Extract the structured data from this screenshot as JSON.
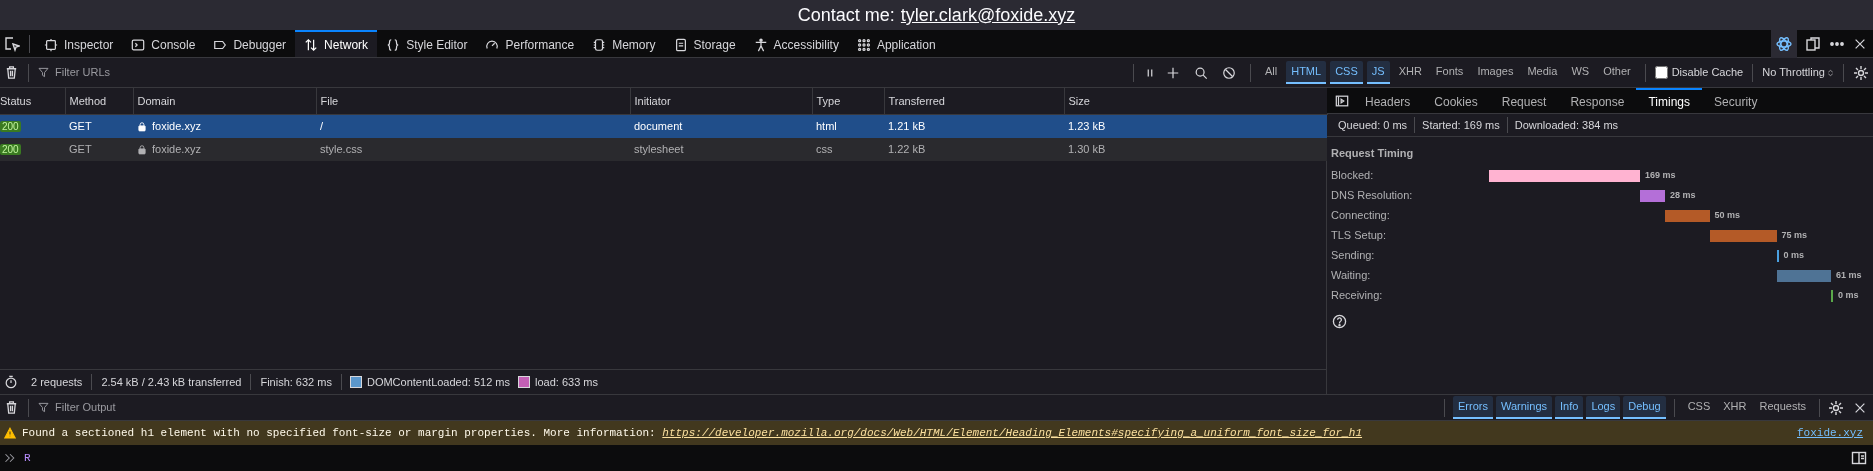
{
  "page": {
    "contact_label": "Contact me:",
    "contact_link": "tyler.clark@foxide.xyz"
  },
  "toolbox_tabs": [
    {
      "kind": "inspector",
      "label": "Inspector",
      "selected": false
    },
    {
      "kind": "console",
      "label": "Console",
      "selected": false
    },
    {
      "kind": "debugger",
      "label": "Debugger",
      "selected": false
    },
    {
      "kind": "network",
      "label": "Network",
      "selected": true
    },
    {
      "kind": "style",
      "label": "Style Editor",
      "selected": false
    },
    {
      "kind": "performance",
      "label": "Performance",
      "selected": false
    },
    {
      "kind": "memory",
      "label": "Memory",
      "selected": false
    },
    {
      "kind": "storage",
      "label": "Storage",
      "selected": false
    },
    {
      "kind": "accessibility",
      "label": "Accessibility",
      "selected": false
    },
    {
      "kind": "application",
      "label": "Application",
      "selected": false
    }
  ],
  "filter_bar": {
    "placeholder": "Filter URLs",
    "type_filters": [
      {
        "label": "All",
        "selected": false
      },
      {
        "label": "HTML",
        "selected": true
      },
      {
        "label": "CSS",
        "selected": true
      },
      {
        "label": "JS",
        "selected": true
      },
      {
        "label": "XHR",
        "selected": false
      },
      {
        "label": "Fonts",
        "selected": false
      },
      {
        "label": "Images",
        "selected": false
      },
      {
        "label": "Media",
        "selected": false
      },
      {
        "label": "WS",
        "selected": false
      },
      {
        "label": "Other",
        "selected": false
      }
    ],
    "disable_cache": {
      "label": "Disable Cache",
      "checked": false
    },
    "throttling": "No Throttling"
  },
  "table": {
    "columns": [
      "Status",
      "Method",
      "Domain",
      "File",
      "Initiator",
      "Type",
      "Transferred",
      "Size"
    ],
    "rows": [
      {
        "status": "200",
        "method": "GET",
        "domain": "foxide.xyz",
        "file": "/",
        "initiator": "document",
        "type": "html",
        "transferred": "1.21 kB",
        "size": "1.23 kB",
        "selected": true
      },
      {
        "status": "200",
        "method": "GET",
        "domain": "foxide.xyz",
        "file": "style.css",
        "initiator": "stylesheet",
        "type": "css",
        "transferred": "1.22 kB",
        "size": "1.30 kB",
        "selected": false
      }
    ]
  },
  "details": {
    "tabs": [
      {
        "label": "Headers",
        "selected": false
      },
      {
        "label": "Cookies",
        "selected": false
      },
      {
        "label": "Request",
        "selected": false
      },
      {
        "label": "Response",
        "selected": false
      },
      {
        "label": "Timings",
        "selected": true
      },
      {
        "label": "Security",
        "selected": false
      }
    ],
    "summary": [
      "Queued: 0 ms",
      "Started: 169 ms",
      "Downloaded: 384 ms"
    ],
    "section_title": "Request Timing",
    "timings": [
      {
        "label": "Blocked:",
        "value": "169 ms",
        "color": "#ffb3d1"
      },
      {
        "label": "DNS Resolution:",
        "value": "28 ms",
        "color": "#b46fd8"
      },
      {
        "label": "Connecting:",
        "value": "50 ms",
        "color": "#b45a27"
      },
      {
        "label": "TLS Setup:",
        "value": "75 ms",
        "color": "#b45a27"
      },
      {
        "label": "Sending:",
        "value": "0 ms",
        "color": "#4aa0e0"
      },
      {
        "label": "Waiting:",
        "value": "61 ms",
        "color": "#4f7395"
      },
      {
        "label": "Receiving:",
        "value": "0 ms",
        "color": "#5aa84a"
      }
    ]
  },
  "status_bar": {
    "items": [
      "2 requests",
      "2.54 kB / 2.43 kB transferred",
      "Finish: 632 ms"
    ],
    "markers": [
      {
        "text": "DOMContentLoaded: 512 ms",
        "color": "#5b97cc"
      },
      {
        "text": "load: 633 ms",
        "color": "#c35fb5"
      }
    ]
  },
  "console": {
    "placeholder": "Filter Output",
    "level_filters": [
      {
        "label": "Errors",
        "selected": true
      },
      {
        "label": "Warnings",
        "selected": true
      },
      {
        "label": "Info",
        "selected": true
      },
      {
        "label": "Logs",
        "selected": true
      },
      {
        "label": "Debug",
        "selected": true
      }
    ],
    "type_filters": [
      {
        "label": "CSS",
        "selected": false
      },
      {
        "label": "XHR",
        "selected": false
      },
      {
        "label": "Requests",
        "selected": false
      }
    ],
    "messages": [
      {
        "kind": "warning",
        "text": "Found a sectioned h1 element with no specified font-size or margin properties. More information: ",
        "link": "https://developer.mozilla.org/docs/Web/HTML/Element/Heading_Elements#specifying_a_uniform_font_size_for_h1",
        "source": "foxide.xyz"
      }
    ],
    "input": "R"
  }
}
